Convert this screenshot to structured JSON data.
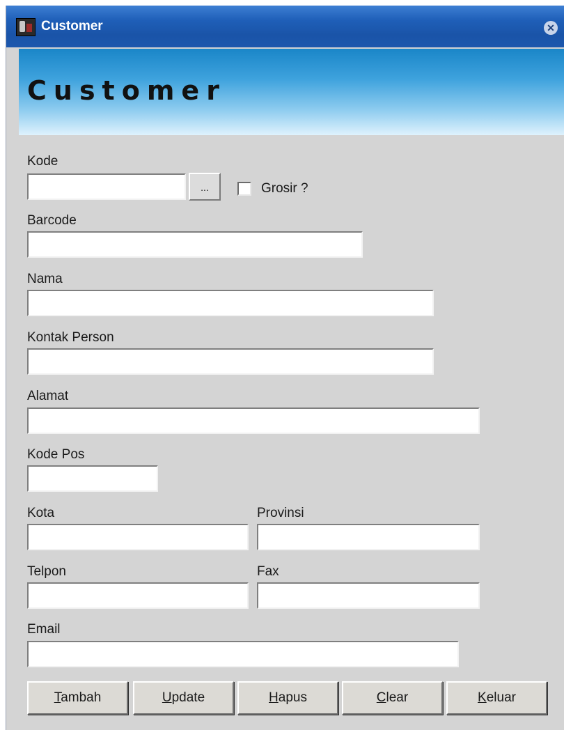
{
  "window": {
    "title": "Customer",
    "close_glyph": "✕"
  },
  "banner": {
    "title": "Customer"
  },
  "form": {
    "kode": {
      "label": "Kode",
      "value": ""
    },
    "lookup_button": "...",
    "grosir": {
      "label": "Grosir ?",
      "checked": false
    },
    "barcode": {
      "label": "Barcode",
      "value": ""
    },
    "nama": {
      "label": "Nama",
      "value": ""
    },
    "kontak_person": {
      "label": "Kontak Person",
      "value": ""
    },
    "alamat": {
      "label": "Alamat",
      "value": ""
    },
    "kode_pos": {
      "label": "Kode Pos",
      "value": ""
    },
    "kota": {
      "label": "Kota",
      "value": ""
    },
    "provinsi": {
      "label": "Provinsi",
      "value": ""
    },
    "telpon": {
      "label": "Telpon",
      "value": ""
    },
    "fax": {
      "label": "Fax",
      "value": ""
    },
    "email": {
      "label": "Email",
      "value": ""
    }
  },
  "buttons": {
    "tambah": {
      "accel": "T",
      "rest": "ambah"
    },
    "update": {
      "accel": "U",
      "rest": "pdate"
    },
    "hapus": {
      "accel": "H",
      "rest": "apus"
    },
    "clear": {
      "accel": "C",
      "rest": "lear"
    },
    "keluar": {
      "accel": "K",
      "rest": "eluar"
    }
  },
  "icons": {
    "app": "app-window-icon",
    "close": "close-icon"
  }
}
